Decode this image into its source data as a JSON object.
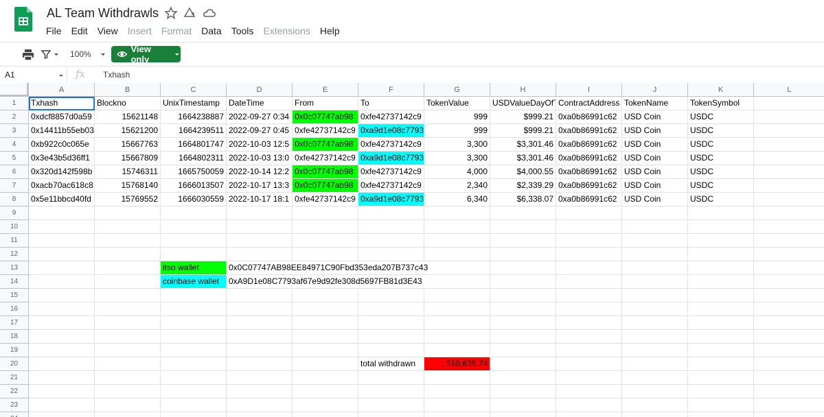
{
  "app": {
    "title": "AL Team Withdrawls",
    "menus": [
      {
        "label": "File",
        "disabled": false
      },
      {
        "label": "Edit",
        "disabled": false
      },
      {
        "label": "View",
        "disabled": false
      },
      {
        "label": "Insert",
        "disabled": true
      },
      {
        "label": "Format",
        "disabled": true
      },
      {
        "label": "Data",
        "disabled": false
      },
      {
        "label": "Tools",
        "disabled": false
      },
      {
        "label": "Extensions",
        "disabled": true
      },
      {
        "label": "Help",
        "disabled": false
      }
    ]
  },
  "toolbar": {
    "zoom": "100%",
    "view_only_label": "View only"
  },
  "formula_bar": {
    "cell_ref": "A1",
    "fx": "fx",
    "value": "Txhash"
  },
  "colors": {
    "green": "#00ff00",
    "cyan": "#00ffff",
    "red": "#ff0000",
    "brand": "#188038",
    "selection": "#1a73e8"
  },
  "sheet": {
    "columns": [
      "A",
      "B",
      "C",
      "D",
      "E",
      "F",
      "G",
      "H",
      "I",
      "J",
      "K",
      "L"
    ],
    "rows": [
      "1",
      "2",
      "3",
      "4",
      "5",
      "6",
      "7",
      "8",
      "9",
      "10",
      "11",
      "12",
      "13",
      "14",
      "15",
      "16",
      "17",
      "18",
      "19",
      "20",
      "21",
      "22",
      "23",
      "24"
    ],
    "header": [
      "Txhash",
      "Blockno",
      "UnixTimestamp",
      "DateTime",
      "From",
      "To",
      "TokenValue",
      "USDValueDayOfTx",
      "ContractAddress",
      "TokenName",
      "TokenSymbol"
    ],
    "data": [
      [
        "0xdcf8857d0a59",
        "15621148",
        "1664238887",
        "2022-09-27 0:34",
        "0x0c07747ab98",
        "0xfe42737142c9",
        "999",
        "$999.21",
        "0xa0b86991c62",
        "USD Coin",
        "USDC"
      ],
      [
        "0x14411b55eb03",
        "15621200",
        "1664239511",
        "2022-09-27 0:45",
        "0xfe42737142c9",
        "0xa9d1e08c7793",
        "999",
        "$999.21",
        "0xa0b86991c62",
        "USD Coin",
        "USDC"
      ],
      [
        "0xb922c0c065e",
        "15667763",
        "1664801747",
        "2022-10-03 12:5",
        "0x0c07747ab98",
        "0xfe42737142c9",
        "3,300",
        "$3,301.46",
        "0xa0b86991c62",
        "USD Coin",
        "USDC"
      ],
      [
        "0x3e43b5d36ff1",
        "15667809",
        "1664802311",
        "2022-10-03 13:0",
        "0xfe42737142c9",
        "0xa9d1e08c7793",
        "3,300",
        "$3,301.46",
        "0xa0b86991c62",
        "USD Coin",
        "USDC"
      ],
      [
        "0x320d142f598b",
        "15746311",
        "1665750059",
        "2022-10-14 12:2",
        "0x0c07747ab98",
        "0xfe42737142c9",
        "4,000",
        "$4,000.55",
        "0xa0b86991c62",
        "USD Coin",
        "USDC"
      ],
      [
        "0xacb70ac618c8",
        "15768140",
        "1666013507",
        "2022-10-17 13:3",
        "0x0c07747ab98",
        "0xfe42737142c9",
        "2,340",
        "$2,339.29",
        "0xa0b86991c62",
        "USD Coin",
        "USDC"
      ],
      [
        "0x5e11bbcd40fd",
        "15769552",
        "1666030559",
        "2022-10-17 18:1",
        "0xfe42737142c9",
        "0xa9d1e08c7793",
        "6,340",
        "$6,338.07",
        "0xa0b86991c62",
        "USD Coin",
        "USDC"
      ]
    ],
    "highlights": [
      [
        "",
        "",
        "",
        "",
        "green",
        "",
        "",
        "",
        "",
        "",
        ""
      ],
      [
        "",
        "",
        "",
        "",
        "",
        "cyan",
        "",
        "",
        "",
        "",
        ""
      ],
      [
        "",
        "",
        "",
        "",
        "green",
        "",
        "",
        "",
        "",
        "",
        ""
      ],
      [
        "",
        "",
        "",
        "",
        "",
        "cyan",
        "",
        "",
        "",
        "",
        ""
      ],
      [
        "",
        "",
        "",
        "",
        "green",
        "",
        "",
        "",
        "",
        "",
        ""
      ],
      [
        "",
        "",
        "",
        "",
        "green",
        "",
        "",
        "",
        "",
        "",
        ""
      ],
      [
        "",
        "",
        "",
        "",
        "",
        "cyan",
        "",
        "",
        "",
        "",
        ""
      ]
    ],
    "wallets": [
      {
        "label": "itso wallet",
        "address": "0x0C07747AB98EE84971C90Fbd353eda207B737c43",
        "color": "green"
      },
      {
        "label": "coinbase wallet",
        "address": "0xA9D1e08C7793af67e9d92fe308d5697FB81d3E43",
        "color": "cyan"
      }
    ],
    "total": {
      "label": "total withdrawn",
      "value": "$10,638.74",
      "color": "red"
    }
  }
}
